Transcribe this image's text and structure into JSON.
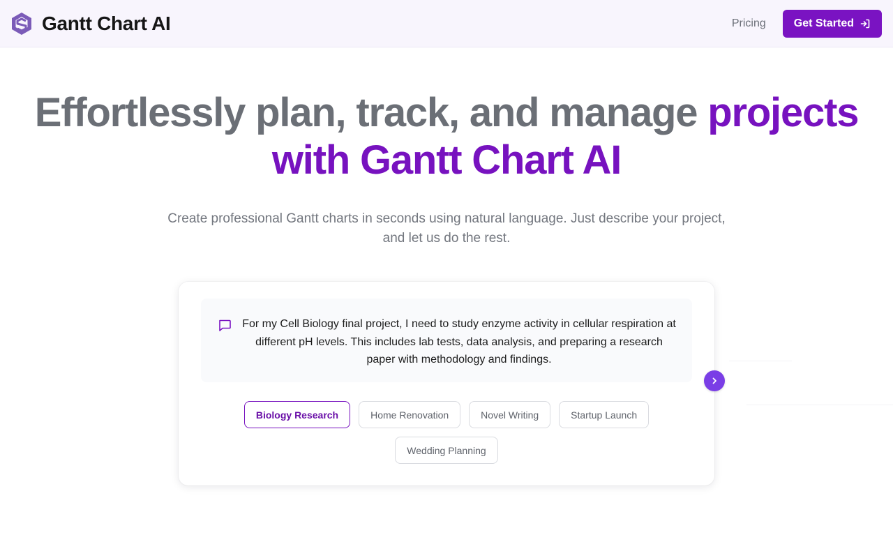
{
  "header": {
    "brand_name": "Gantt Chart AI",
    "nav": {
      "pricing_label": "Pricing"
    },
    "cta_label": "Get Started"
  },
  "hero": {
    "headline_plain": "Effortlessly plan, track, and manage ",
    "headline_accent": "projects with Gantt Chart AI",
    "subtitle": "Create professional Gantt charts in seconds using natural language. Just describe your project, and let us do the rest."
  },
  "prompt": {
    "text": "For my Cell Biology final project, I need to study enzyme activity in cellular respiration at different pH levels. This includes lab tests, data analysis, and preparing a research paper with methodology and findings."
  },
  "examples": [
    {
      "label": "Biology Research",
      "active": true
    },
    {
      "label": "Home Renovation",
      "active": false
    },
    {
      "label": "Novel Writing",
      "active": false
    },
    {
      "label": "Startup Launch",
      "active": false
    },
    {
      "label": "Wedding Planning",
      "active": false
    }
  ],
  "colors": {
    "brand": "#7a13c2",
    "accent_text": "#7712bf",
    "next_button": "#7a3ee6",
    "header_bg": "#f8f5fd"
  },
  "icons": {
    "logo": "gantt-logo-icon",
    "cta": "login-arrow-icon",
    "prompt": "chat-bubble-icon",
    "next": "chevron-right-icon"
  }
}
